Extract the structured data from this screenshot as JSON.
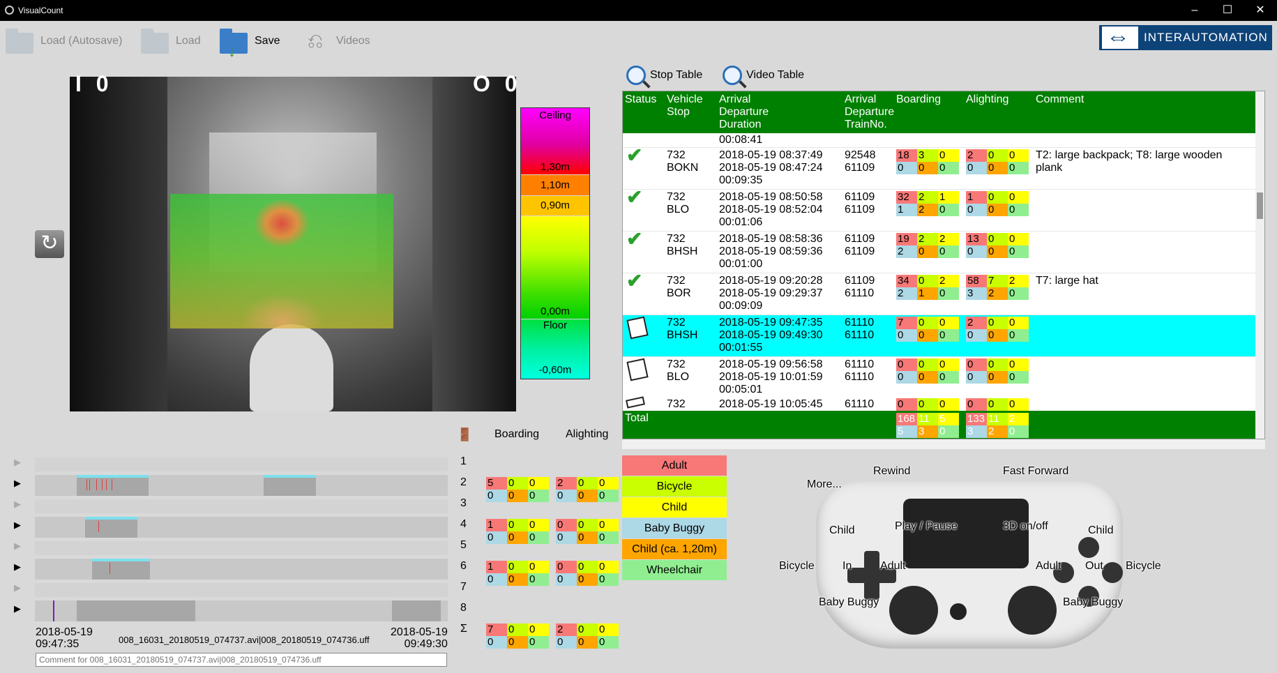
{
  "window": {
    "title": "VisualCount",
    "minimize": "–",
    "maximize": "☐",
    "close": "✕"
  },
  "toolbar": {
    "load_autosave": "Load (Autosave)",
    "load": "Load",
    "save": "Save",
    "videos": "Videos",
    "logo": "INTERAUTOMATION"
  },
  "camera": {
    "in_counter": "I 0",
    "out_counter": "O 0"
  },
  "height_scale": {
    "ceiling": "Ceiling",
    "h130": "1,30m",
    "h110": "1,10m",
    "h090": "0,90m",
    "h000": "0,00m",
    "floor": "Floor",
    "hm060": "-0,60m"
  },
  "tabs": {
    "stop_table": "Stop Table",
    "video_table": "Video Table"
  },
  "table": {
    "headers": {
      "status": "Status",
      "vehicle": "Vehicle",
      "stop": "Stop",
      "arrival": "Arrival",
      "departure": "Departure",
      "duration": "Duration",
      "arrival2": "Arrival",
      "departure2": "Departure",
      "trainno": "TrainNo.",
      "boarding": "Boarding",
      "alighting": "Alighting",
      "comment": "Comment"
    },
    "first_duration": "00:08:41",
    "rows": [
      {
        "vehicle": "732",
        "stop": "BOKN",
        "arr": "2018-05-19 08:37:49",
        "dep": "2018-05-19 08:47:24",
        "dur": "00:09:35",
        "tn1": "92548",
        "tn2": "61109",
        "b": [
          "18",
          "3",
          "0",
          "0",
          "0",
          "0"
        ],
        "a": [
          "2",
          "0",
          "0",
          "0",
          "0",
          "0"
        ],
        "comment": "T2: large backpack; T8: large wooden",
        "comment2": "plank",
        "status": "check"
      },
      {
        "vehicle": "732",
        "stop": "BLO",
        "arr": "2018-05-19 08:50:58",
        "dep": "2018-05-19 08:52:04",
        "dur": "00:01:06",
        "tn1": "61109",
        "tn2": "61109",
        "b": [
          "32",
          "2",
          "1",
          "1",
          "2",
          "0"
        ],
        "a": [
          "1",
          "0",
          "0",
          "0",
          "0",
          "0"
        ],
        "comment": "",
        "comment2": "",
        "status": "check"
      },
      {
        "vehicle": "732",
        "stop": "BHSH",
        "arr": "2018-05-19 08:58:36",
        "dep": "2018-05-19 08:59:36",
        "dur": "00:01:00",
        "tn1": "61109",
        "tn2": "61109",
        "b": [
          "19",
          "2",
          "2",
          "2",
          "0",
          "0"
        ],
        "a": [
          "13",
          "0",
          "0",
          "0",
          "0",
          "0"
        ],
        "comment": "",
        "comment2": "",
        "status": "check"
      },
      {
        "vehicle": "732",
        "stop": "BOR",
        "arr": "2018-05-19 09:20:28",
        "dep": "2018-05-19 09:29:37",
        "dur": "00:09:09",
        "tn1": "61109",
        "tn2": "61110",
        "b": [
          "34",
          "0",
          "2",
          "2",
          "1",
          "0"
        ],
        "a": [
          "58",
          "7",
          "2",
          "3",
          "2",
          "0"
        ],
        "comment": "T7: large hat",
        "comment2": "",
        "status": "check"
      },
      {
        "vehicle": "732",
        "stop": "BHSH",
        "arr": "2018-05-19 09:47:35",
        "dep": "2018-05-19 09:49:30",
        "dur": "00:01:55",
        "tn1": "61110",
        "tn2": "61110",
        "b": [
          "7",
          "0",
          "0",
          "0",
          "0",
          "0"
        ],
        "a": [
          "2",
          "0",
          "0",
          "0",
          "0",
          "0"
        ],
        "comment": "",
        "comment2": "",
        "status": "pad",
        "selected": true
      },
      {
        "vehicle": "732",
        "stop": "BLO",
        "arr": "2018-05-19 09:56:58",
        "dep": "2018-05-19 10:01:59",
        "dur": "00:05:01",
        "tn1": "61110",
        "tn2": "61110",
        "b": [
          "0",
          "0",
          "0",
          "0",
          "0",
          "0"
        ],
        "a": [
          "0",
          "0",
          "0",
          "0",
          "0",
          "0"
        ],
        "comment": "",
        "comment2": "",
        "status": "pad"
      }
    ],
    "partial": {
      "vehicle": "732",
      "arr": "2018-05-19 10:05:45",
      "tn1": "61110",
      "b": [
        "0",
        "0",
        "0"
      ],
      "a": [
        "0",
        "0",
        "0"
      ]
    },
    "total": {
      "label": "Total",
      "b": [
        "168",
        "11",
        "5",
        "5",
        "3",
        "0"
      ],
      "a": [
        "133",
        "11",
        "2",
        "3",
        "2",
        "0"
      ]
    }
  },
  "doors": {
    "boarding": "Boarding",
    "alighting": "Alighting",
    "rows": [
      {
        "n": "1"
      },
      {
        "n": "2",
        "b": [
          "5",
          "0",
          "0",
          "0",
          "0",
          "0"
        ],
        "a": [
          "2",
          "0",
          "0",
          "0",
          "0",
          "0"
        ]
      },
      {
        "n": "3"
      },
      {
        "n": "4",
        "b": [
          "1",
          "0",
          "0",
          "0",
          "0",
          "0"
        ],
        "a": [
          "0",
          "0",
          "0",
          "0",
          "0",
          "0"
        ]
      },
      {
        "n": "5"
      },
      {
        "n": "6",
        "b": [
          "1",
          "0",
          "0",
          "0",
          "0",
          "0"
        ],
        "a": [
          "0",
          "0",
          "0",
          "0",
          "0",
          "0"
        ]
      },
      {
        "n": "7"
      },
      {
        "n": "8"
      }
    ],
    "sigma": "Σ",
    "sum_b": [
      "7",
      "0",
      "0",
      "0",
      "0",
      "0"
    ],
    "sum_a": [
      "2",
      "0",
      "0",
      "0",
      "0",
      "0"
    ]
  },
  "timeline": {
    "start_date": "2018-05-19",
    "start_time": "09:47:35",
    "file": "008_16031_20180519_074737.avi|008_20180519_074736.uff",
    "end_date": "2018-05-19",
    "end_time": "09:49:30",
    "comment_placeholder": "Comment for 008_16031_20180519_074737.avi|008_20180519_074736.uff"
  },
  "legend": {
    "adult": "Adult",
    "bicycle": "Bicycle",
    "child": "Child",
    "baby_buggy": "Baby Buggy",
    "child120": "Child (ca. 1,20m)",
    "wheelchair": "Wheelchair"
  },
  "controller": {
    "more": "More...",
    "rewind": "Rewind",
    "ff": "Fast Forward",
    "play": "Play / Pause",
    "threed": "3D on/off",
    "child_l": "Child",
    "child_r": "Child",
    "bicycle_l": "Bicycle",
    "in": "In",
    "adult_l": "Adult",
    "adult_r": "Adult",
    "out": "Out",
    "bicycle_r": "Bicycle",
    "bb_l": "Baby Buggy",
    "bb_r": "Baby Buggy"
  }
}
